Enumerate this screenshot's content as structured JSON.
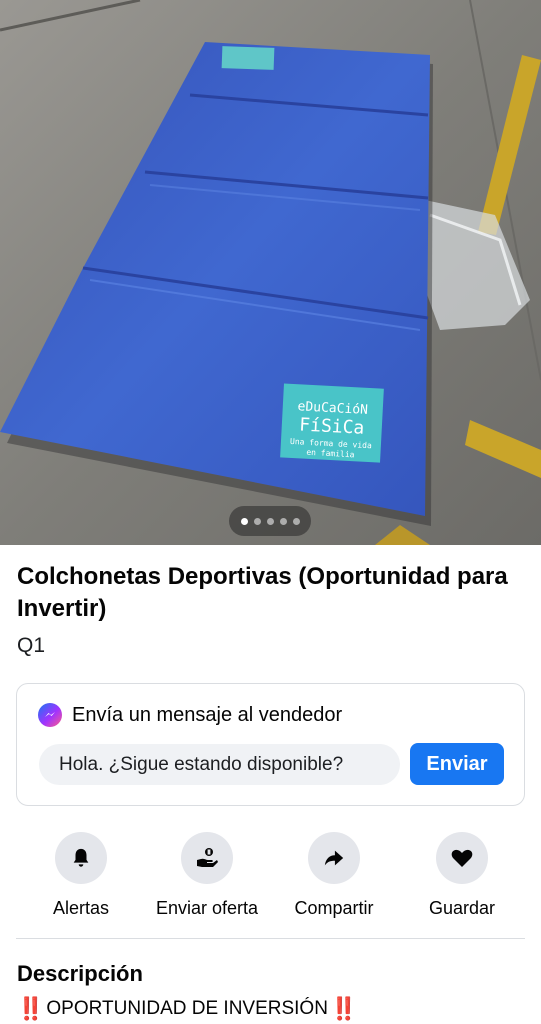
{
  "listing": {
    "title": "Colchonetas Deportivas (Oportunidad para Invertir)",
    "price": "Q1"
  },
  "gallery": {
    "image_count": 5,
    "active_index": 0,
    "mat_logo_line1": "eDuCaCióN",
    "mat_logo_line2": "FíSiCa",
    "mat_logo_line3": "Una forma de vida",
    "mat_logo_line4": "en familia"
  },
  "message": {
    "heading": "Envía un mensaje al vendedor",
    "input_value": "Hola. ¿Sigue estando disponible?",
    "send_label": "Enviar"
  },
  "actions": [
    {
      "label": "Alertas",
      "icon": "bell-icon"
    },
    {
      "label": "Enviar oferta",
      "icon": "offer-icon"
    },
    {
      "label": "Compartir",
      "icon": "share-icon"
    },
    {
      "label": "Guardar",
      "icon": "heart-icon"
    }
  ],
  "description": {
    "heading": "Descripción",
    "first_line": "OPORTUNIDAD DE INVERSIÓN",
    "emoji": "‼️"
  },
  "colors": {
    "accent": "#1877f2",
    "mat_blue": "#3b5fc4",
    "emphasis_red": "#e0245e"
  }
}
